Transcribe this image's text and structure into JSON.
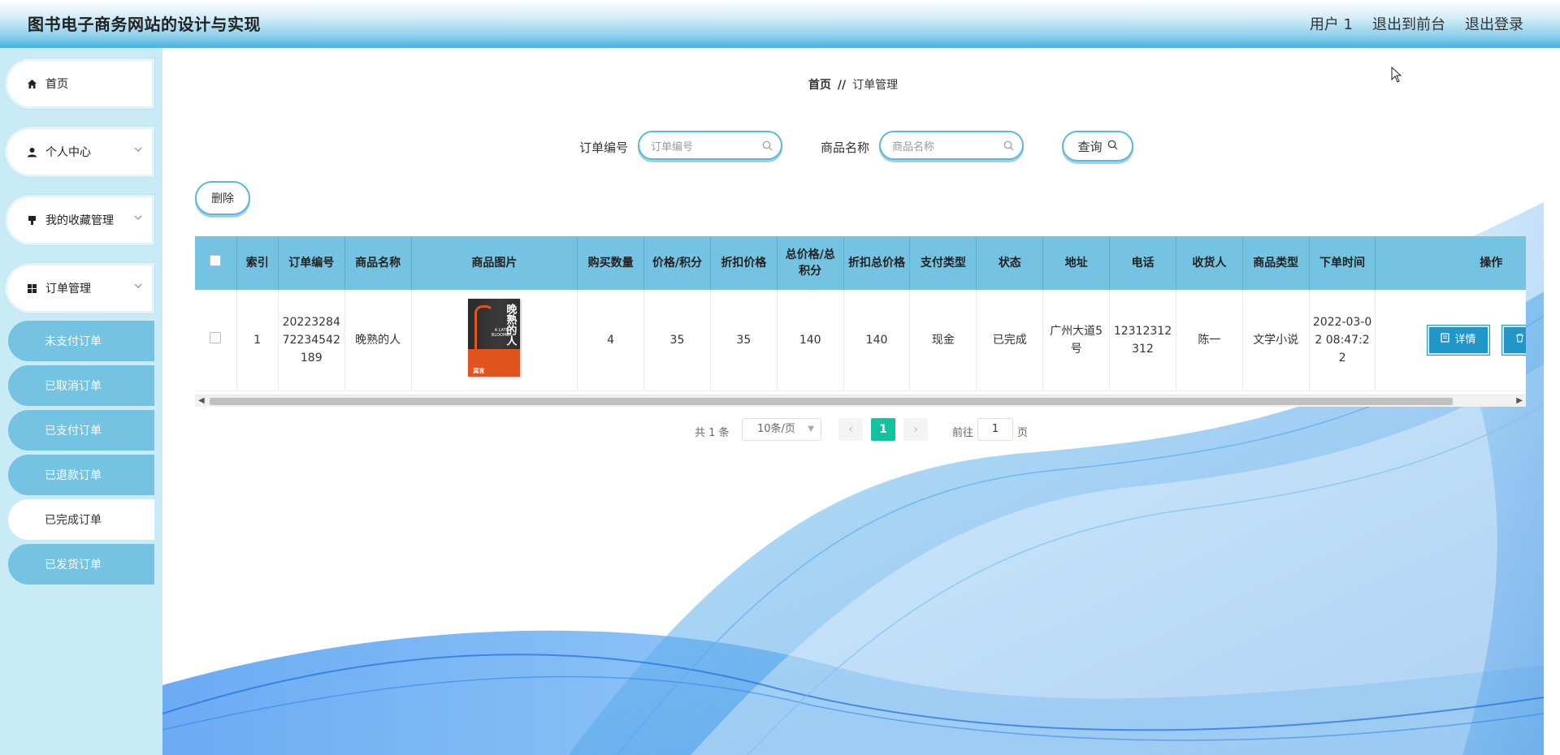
{
  "header": {
    "title": "图书电子商务网站的设计与实现",
    "user": "用户 1",
    "back_front": "退出到前台",
    "logout": "退出登录"
  },
  "sidebar": {
    "items": [
      {
        "label": "首页",
        "icon": "home-icon"
      },
      {
        "label": "个人中心",
        "icon": "user-icon"
      },
      {
        "label": "我的收藏管理",
        "icon": "bookmark-icon"
      },
      {
        "label": "订单管理",
        "icon": "grid-icon"
      }
    ],
    "submenu": [
      {
        "label": "未支付订单"
      },
      {
        "label": "已取消订单"
      },
      {
        "label": "已支付订单"
      },
      {
        "label": "已退款订单"
      },
      {
        "label": "已完成订单",
        "active": true
      },
      {
        "label": "已发货订单"
      }
    ]
  },
  "breadcrumb": {
    "home": "首页",
    "sep": "//",
    "current": "订单管理"
  },
  "search": {
    "order_no_label": "订单编号",
    "order_no_placeholder": "订单编号",
    "goods_label": "商品名称",
    "goods_placeholder": "商品名称",
    "query_button": "查询"
  },
  "toolbar": {
    "delete_label": "删除"
  },
  "table": {
    "headers": [
      "索引",
      "订单编号",
      "商品名称",
      "商品图片",
      "购买数量",
      "价格/积分",
      "折扣价格",
      "总价格/总积分",
      "折扣总价格",
      "支付类型",
      "状态",
      "地址",
      "电话",
      "收货人",
      "商品类型",
      "下单时间",
      "操作"
    ],
    "rows": [
      {
        "index": "1",
        "order_no": "2022328472234542189",
        "goods_name": "晚熟的人",
        "cover_title": "晚熟的人",
        "cover_subtitle": "A LATE BLOOMER",
        "cover_author": "莫言",
        "quantity": "4",
        "price": "35",
        "discount_price": "35",
        "total": "140",
        "discount_total": "140",
        "pay_type": "现金",
        "status": "已完成",
        "address": "广州大道5号",
        "phone": "12312312312",
        "receiver": "陈一",
        "goods_type": "文学小说",
        "order_time": "2022-03-02 08:47:22",
        "detail_label": "详情",
        "delete_label": "删除"
      }
    ]
  },
  "pagination": {
    "total": "共 1 条",
    "page_size": "10条/页",
    "current": "1",
    "goto": "前往",
    "goto_value": "1",
    "page_unit": "页"
  }
}
